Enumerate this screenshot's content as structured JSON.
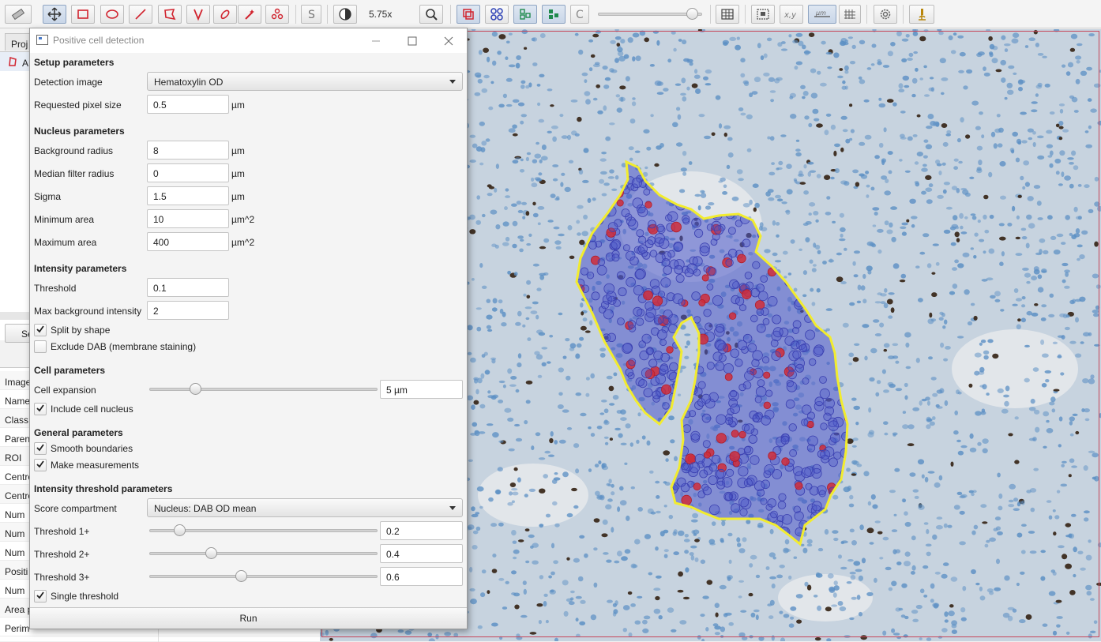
{
  "toolbar": {
    "zoom_label": "5.75x",
    "icons": [
      "move-icon",
      "rectangle-icon",
      "ellipse-icon",
      "line-icon",
      "polygon-icon",
      "polyline-icon",
      "brush-icon",
      "wand-icon",
      "points-icon",
      "selection-mode-icon",
      "brightness-contrast-icon",
      "zoom-fit-icon",
      "show-annotations-icon",
      "show-tma-grid-icon",
      "show-detections-icon",
      "fill-detections-icon",
      "cell-mode-icon",
      "grid-icon",
      "overview-icon",
      "pixel-coordinates-icon",
      "scalebar-icon",
      "counting-grid-icon",
      "settings-icon",
      "microscope-icon"
    ],
    "opacity": 0.9
  },
  "left_panel": {
    "project_tab": "Proj",
    "annotation_row": "A",
    "button_label": "Se",
    "measurement_rows": [
      "Image",
      "Name",
      "Class",
      "Parent",
      "ROI",
      "Centro",
      "Centro",
      "Num",
      "Num",
      "Num",
      "Positi",
      "Num",
      "Area p",
      "Perim"
    ]
  },
  "dialog": {
    "title": "Positive cell detection",
    "setup": {
      "heading": "Setup parameters",
      "detection_image_label": "Detection image",
      "detection_image_value": "Hematoxylin OD",
      "pixel_size_label": "Requested pixel size",
      "pixel_size_value": "0.5",
      "pixel_size_unit": "µm"
    },
    "nucleus": {
      "heading": "Nucleus parameters",
      "background_radius_label": "Background radius",
      "background_radius_value": "8",
      "background_radius_unit": "µm",
      "median_label": "Median filter radius",
      "median_value": "0",
      "median_unit": "µm",
      "sigma_label": "Sigma",
      "sigma_value": "1.5",
      "sigma_unit": "µm",
      "min_area_label": "Minimum area",
      "min_area_value": "10",
      "min_area_unit": "µm^2",
      "max_area_label": "Maximum area",
      "max_area_value": "400",
      "max_area_unit": "µm^2"
    },
    "intensity": {
      "heading": "Intensity parameters",
      "threshold_label": "Threshold",
      "threshold_value": "0.1",
      "max_bg_label": "Max background intensity",
      "max_bg_value": "2",
      "split_label": "Split by shape",
      "split_checked": true,
      "exclude_dab_label": "Exclude DAB (membrane staining)",
      "exclude_dab_checked": false
    },
    "cell": {
      "heading": "Cell parameters",
      "expansion_label": "Cell expansion",
      "expansion_value": "5 µm",
      "expansion_slider": 0.2,
      "include_nucleus_label": "Include cell nucleus",
      "include_nucleus_checked": true
    },
    "general": {
      "heading": "General parameters",
      "smooth_label": "Smooth boundaries",
      "smooth_checked": true,
      "measurements_label": "Make measurements",
      "measurements_checked": true
    },
    "threshold_params": {
      "heading": "Intensity threshold parameters",
      "score_label": "Score compartment",
      "score_value": "Nucleus: DAB OD mean",
      "t1_label": "Threshold 1+",
      "t1_value": "0.2",
      "t1_slider": 0.13,
      "t2_label": "Threshold 2+",
      "t2_value": "0.4",
      "t2_slider": 0.27,
      "t3_label": "Threshold 3+",
      "t3_value": "0.6",
      "t3_slider": 0.4,
      "single_label": "Single threshold",
      "single_checked": true
    },
    "run_label": "Run"
  },
  "colors": {
    "annotation_outline": "#f2ec2e",
    "negative_cells": "#4a55c8",
    "positive_cells": "#d02d3a",
    "tissue_background": "#c7d3df",
    "hematoxylin_nuclei": "#5b8fc4",
    "dab_nuclei": "#3b2a1c"
  }
}
